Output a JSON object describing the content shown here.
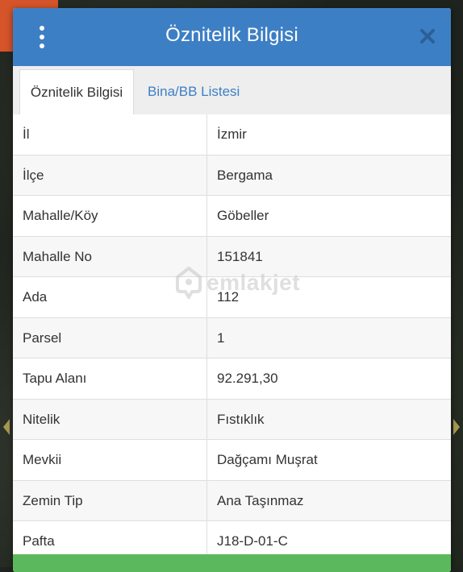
{
  "dialog": {
    "title": "Öznitelik Bilgisi"
  },
  "tabs": [
    {
      "label": "Öznitelik Bilgisi",
      "active": true
    },
    {
      "label": "Bina/BB Listesi",
      "active": false
    }
  ],
  "attributes": [
    {
      "key": "İl",
      "value": "İzmir"
    },
    {
      "key": "İlçe",
      "value": "Bergama"
    },
    {
      "key": "Mahalle/Köy",
      "value": "Göbeller"
    },
    {
      "key": "Mahalle No",
      "value": "151841"
    },
    {
      "key": "Ada",
      "value": "112"
    },
    {
      "key": "Parsel",
      "value": "1"
    },
    {
      "key": "Tapu Alanı",
      "value": "92.291,30"
    },
    {
      "key": "Nitelik",
      "value": "Fıstıklık"
    },
    {
      "key": "Mevkii",
      "value": "Dağçamı Muşrat"
    },
    {
      "key": "Zemin Tip",
      "value": "Ana Taşınmaz"
    },
    {
      "key": "Pafta",
      "value": "J18-D-01-C"
    }
  ],
  "watermark": {
    "text": "emlakjet"
  },
  "colors": {
    "header": "#3d7fc4",
    "tab_link": "#3d7fc4",
    "footer": "#5cb85c",
    "background_accent": "#d5542a"
  }
}
